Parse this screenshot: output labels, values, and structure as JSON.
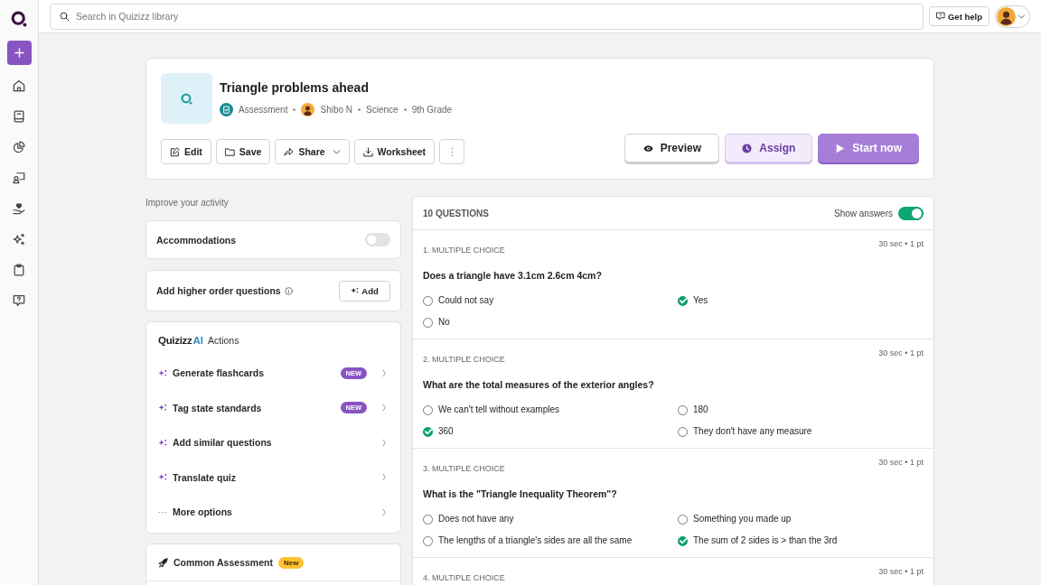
{
  "search": {
    "placeholder": "Search in Quizizz library"
  },
  "help_button": "Get help",
  "quiz": {
    "title": "Triangle problems ahead",
    "meta": [
      {
        "kind": "type",
        "text": "Assessment"
      },
      {
        "kind": "author",
        "text": "Shibo N"
      },
      {
        "kind": "subject",
        "text": "Science"
      },
      {
        "kind": "grade",
        "text": "9th Grade"
      }
    ],
    "actions": [
      {
        "kind": "edit",
        "label": "Edit",
        "dropdown": false
      },
      {
        "kind": "save",
        "label": "Save",
        "dropdown": false
      },
      {
        "kind": "share",
        "label": "Share",
        "dropdown": true
      },
      {
        "kind": "worksheet",
        "label": "Worksheet",
        "dropdown": false
      },
      {
        "kind": "more",
        "dropdown": false
      }
    ],
    "primary_actions": [
      {
        "kind": "preview",
        "label": "Preview"
      },
      {
        "kind": "assign",
        "label": "Assign"
      },
      {
        "kind": "start",
        "label": "Start now"
      }
    ]
  },
  "improve": {
    "heading": "Improve your activity",
    "accommodations": {
      "label": "Accommodations",
      "on": false
    },
    "higher_order": {
      "label": "Add higher order questions",
      "button": "Add"
    },
    "ai_actions": {
      "brand": "Quizizz",
      "brand_ai": "AI",
      "title": "Actions",
      "items": [
        {
          "kind": "ai",
          "label": "Generate flashcards",
          "badge": "NEW"
        },
        {
          "kind": "ai",
          "label": "Tag state standards",
          "badge": "NEW"
        },
        {
          "kind": "ai",
          "label": "Add similar questions"
        },
        {
          "kind": "ai",
          "label": "Translate quiz"
        },
        {
          "kind": "more",
          "label": "More options"
        }
      ]
    },
    "common_assessment": {
      "label": "Common Assessment",
      "badge": "New"
    }
  },
  "questions_panel": {
    "count": "10 QUESTIONS",
    "show_answers": {
      "label": "Show answers",
      "on": true
    },
    "questions": [
      {
        "type": "1. MULTIPLE CHOICE",
        "meta": "30 sec • 1 pt",
        "text": "Does a triangle have 3.1cm 2.6cm 4cm?",
        "options": [
          {
            "text": "Could not say",
            "correct": false
          },
          {
            "text": "Yes",
            "correct": true
          },
          {
            "text": "No",
            "correct": false
          }
        ]
      },
      {
        "type": "2. MULTIPLE CHOICE",
        "meta": "30 sec • 1 pt",
        "text": "What are the total measures of the exterior angles?",
        "options": [
          {
            "text": "We can't tell without examples",
            "correct": false
          },
          {
            "text": "180",
            "correct": false
          },
          {
            "text": "360",
            "correct": true
          },
          {
            "text": "They don't have any measure",
            "correct": false
          }
        ]
      },
      {
        "type": "3. MULTIPLE CHOICE",
        "meta": "30 sec • 1 pt",
        "text": "What is the \"Triangle Inequality Theorem\"?",
        "options": [
          {
            "text": "Does not have any",
            "correct": false
          },
          {
            "text": "Something you made up",
            "correct": false
          },
          {
            "text": "The lengths of a triangle's sides are all the same",
            "correct": false
          },
          {
            "text": "The sum of 2 sides is > than the 3rd",
            "correct": true
          }
        ]
      },
      {
        "type": "4. MULTIPLE CHOICE",
        "meta": "30 sec • 1 pt"
      }
    ]
  }
}
